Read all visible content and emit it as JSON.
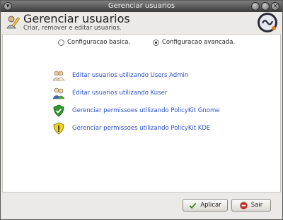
{
  "window": {
    "title": "Gerenciar usuarios"
  },
  "header": {
    "title": "Gerenciar usuarios",
    "subtitle": "Criar, remover e editar usuarios."
  },
  "mode": {
    "options": [
      {
        "label": "Configuracao basica.",
        "checked": false
      },
      {
        "label": "Configuracao avancada.",
        "checked": true
      }
    ]
  },
  "links": [
    {
      "label": "Editar usuarios utilizando Users Admin",
      "icon": "users-admin-icon"
    },
    {
      "label": "Editar usuarios utilizando Kuser",
      "icon": "kuser-icon"
    },
    {
      "label": "Gerenciar permissoes utilizando PolicyKit Gnome",
      "icon": "shield-green-icon"
    },
    {
      "label": "Gerenciar permissoes utilizando PolicyKit KDE",
      "icon": "shield-yellow-icon"
    }
  ],
  "footer": {
    "apply_label": "Aplicar",
    "exit_label": "Sair"
  }
}
